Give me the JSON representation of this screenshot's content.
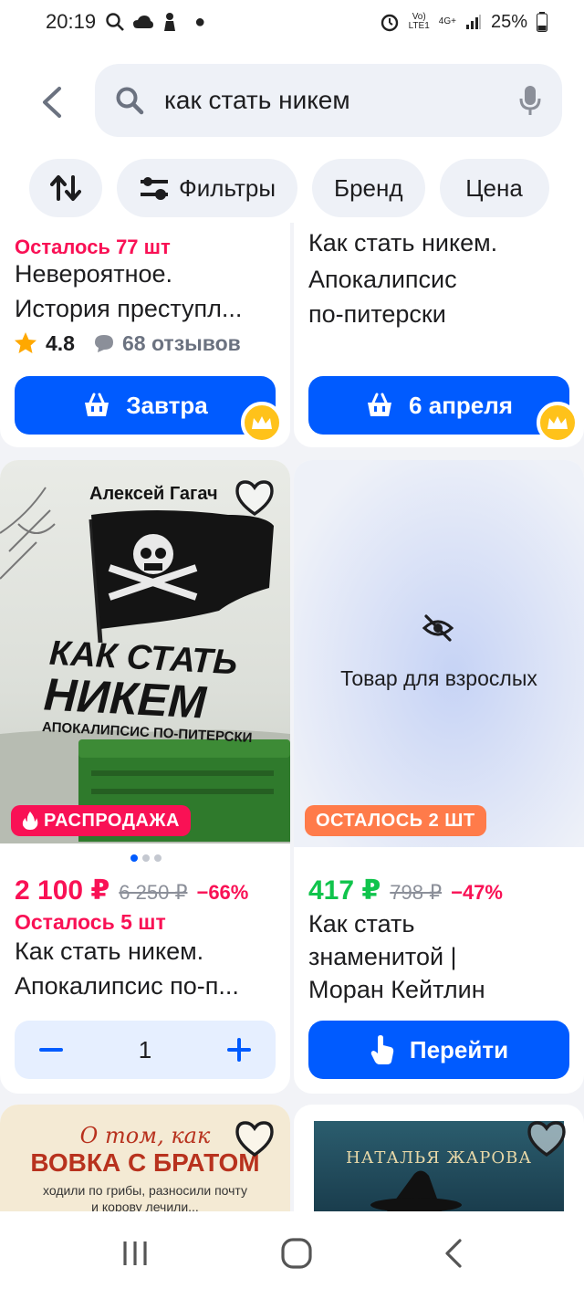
{
  "status_bar": {
    "time": "20:19",
    "network_top": "Vo)",
    "network_bottom": "LTE1",
    "gen_top": "4G+",
    "battery": "25%"
  },
  "search": {
    "query": "как стать никем",
    "back_icon": "back-arrow-icon",
    "mic_icon": "mic-icon"
  },
  "chips": {
    "filters": "Фильтры",
    "brand": "Бренд",
    "price": "Цена"
  },
  "top_cards": [
    {
      "partial_line": "Осталось 77 шт",
      "title_1": "Невероятное.",
      "title_2": "История преступл...",
      "rating": "4.8",
      "reviews": "68 отзывов",
      "button": "Завтра"
    },
    {
      "partial_line": "Как стать никем.",
      "title_1": "Апокалипсис",
      "title_2": "по-питерски",
      "button": "6 апреля"
    }
  ],
  "product_left": {
    "cover_author": "Алексей Гагач",
    "cover_title_1": "КАК СТАТЬ",
    "cover_title_2": "НИКЕМ",
    "cover_subtitle": "АПОКАЛИПСИС ПО-ПИТЕРСКИ",
    "badge": "РАСПРОДАЖА",
    "price": "2 100 ₽",
    "old_price": "6 250 ₽",
    "discount": "−66%",
    "stock": "Осталось 5 шт",
    "title_1": "Как стать никем.",
    "title_2": "Апокалипсис по-п...",
    "quantity": "1"
  },
  "product_right": {
    "adult_label": "Товар для взрослых",
    "badge": "ОСТАЛОСЬ 2 ШТ",
    "price": "417 ₽",
    "old_price": "798 ₽",
    "discount": "−47%",
    "title_1": "Как стать",
    "title_2": "знаменитой |",
    "title_3": "Моран Кейтлин",
    "button": "Перейти"
  },
  "bottom_cards": {
    "left_script": "О том, как",
    "left_title": "ВОВКА С БРАТОМ",
    "left_sub_1": "ходили по грибы, разносили почту",
    "left_sub_2": "и корову лечили...",
    "right_author": "НАТАЛЬЯ ЖАРОВА"
  },
  "colors": {
    "accent": "#005bff",
    "sale": "#f91155",
    "green_price": "#10c44c",
    "crown": "#ffc21a",
    "badge_orange": "#ff7b4a"
  }
}
